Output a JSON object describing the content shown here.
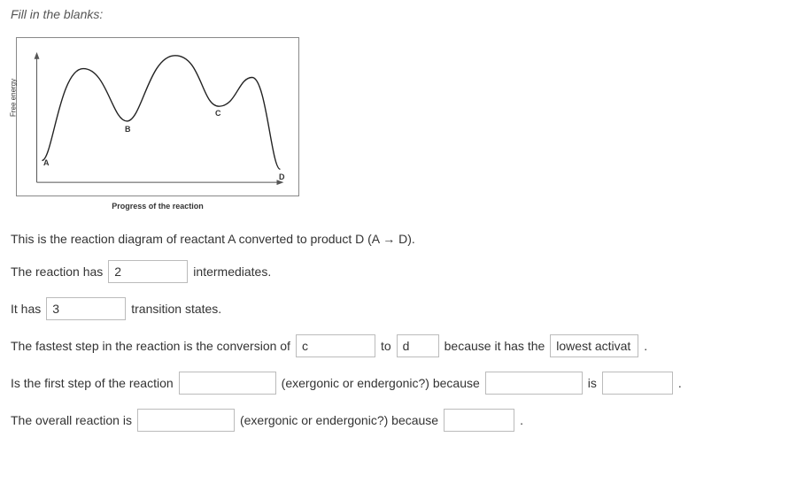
{
  "instruction": "Fill in the blanks:",
  "diagram": {
    "y_axis": "Free energy",
    "x_axis": "Progress of the reaction",
    "labels": {
      "A": "A",
      "B": "B",
      "C": "C",
      "D": "D"
    }
  },
  "lines": {
    "intro": "This is the reaction diagram of reactant A converted to product D  (A  →  D).",
    "l1_pre": "The reaction has",
    "l1_val": "2",
    "l1_post": "intermediates.",
    "l2_pre": "It has",
    "l2_val": "3",
    "l2_post": "transition states.",
    "l3_pre": "The fastest step in the reaction is the conversion of",
    "l3_v1": "c",
    "l3_mid1": "to",
    "l3_v2": "d",
    "l3_mid2": "because it has the",
    "l3_v3": "lowest activat",
    "l3_end": ".",
    "l4_pre": "Is the first step of the reaction",
    "l4_v1": "",
    "l4_mid1": "(exergonic or endergonic?) because",
    "l4_v2": "",
    "l4_mid2": "is",
    "l4_v3": "",
    "l4_end": ".",
    "l5_pre": "The overall reaction is",
    "l5_v1": "",
    "l5_mid1": "(exergonic or endergonic?) because",
    "l5_v2": "",
    "l5_end": "."
  }
}
